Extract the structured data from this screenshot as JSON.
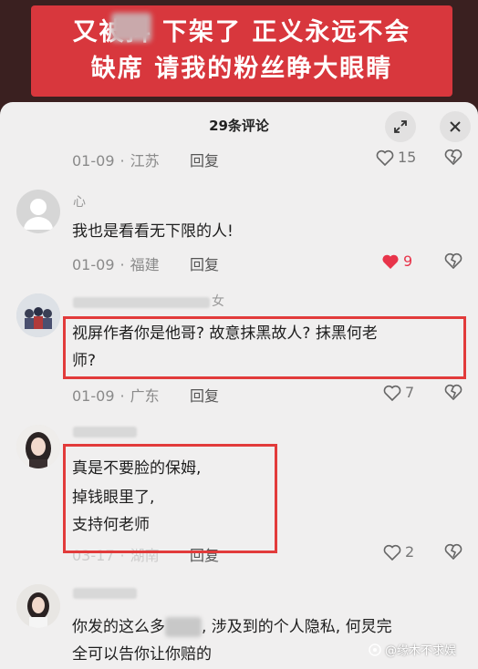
{
  "banner": {
    "line1": "又被抖  下架了  正义永远不会",
    "line2": "缺席 请我的粉丝睁大眼睛"
  },
  "sheet": {
    "title": "29条评论"
  },
  "comments": [
    {
      "date": "01-09",
      "location": "江苏",
      "reply": "回复",
      "likes": "15",
      "liked": false
    },
    {
      "username": "心",
      "text": "我也是看看无下限的人!",
      "date": "01-09",
      "location": "福建",
      "reply": "回复",
      "likes": "9",
      "liked": true
    },
    {
      "username_fragment": "女",
      "line1": "视屏作者你是他哥? 故意抹黑故人? 抹黑何老",
      "line2": "师?",
      "date": "01-09",
      "location": "广东",
      "reply": "回复",
      "likes": "7",
      "liked": false
    },
    {
      "line1": "真是不要脸的保姆,",
      "line2": "掉钱眼里了,",
      "line3": "支持何老师",
      "date": "03-17",
      "location": "湖南",
      "reply": "回复",
      "likes": "2",
      "liked": false
    },
    {
      "line1_a": "你发的这么多",
      "line1_b": ", 涉及到的个人隐私, 何炅完",
      "line2": "全可以告你让你赔的"
    }
  ],
  "watermark": "@缘木不求娱",
  "colors": {
    "banner_red": "#d8373d",
    "highlight_box": "#e23b3b",
    "liked_heart": "#e8344a"
  }
}
